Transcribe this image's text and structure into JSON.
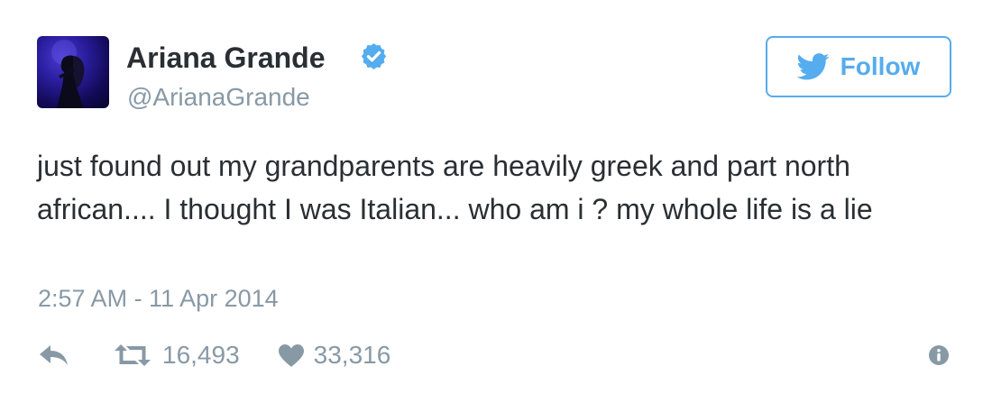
{
  "user": {
    "display_name": "Ariana Grande",
    "handle": "@ArianaGrande",
    "verified": true
  },
  "follow_button": {
    "label": "Follow",
    "icon": "twitter-bird-icon"
  },
  "tweet": {
    "text": "just found out my grandparents are heavily greek and part north african.... I thought I was Italian... who am i ? my whole life is a lie",
    "timestamp": "2:57 AM - 11 Apr 2014"
  },
  "actions": {
    "reply_icon": "reply-icon",
    "retweet_icon": "retweet-icon",
    "retweet_count": "16,493",
    "like_icon": "heart-icon",
    "like_count": "33,316",
    "info_icon": "info-icon"
  },
  "colors": {
    "accent": "#55acee",
    "verified": "#55acee",
    "text": "#292f33",
    "muted": "#8899a6"
  }
}
